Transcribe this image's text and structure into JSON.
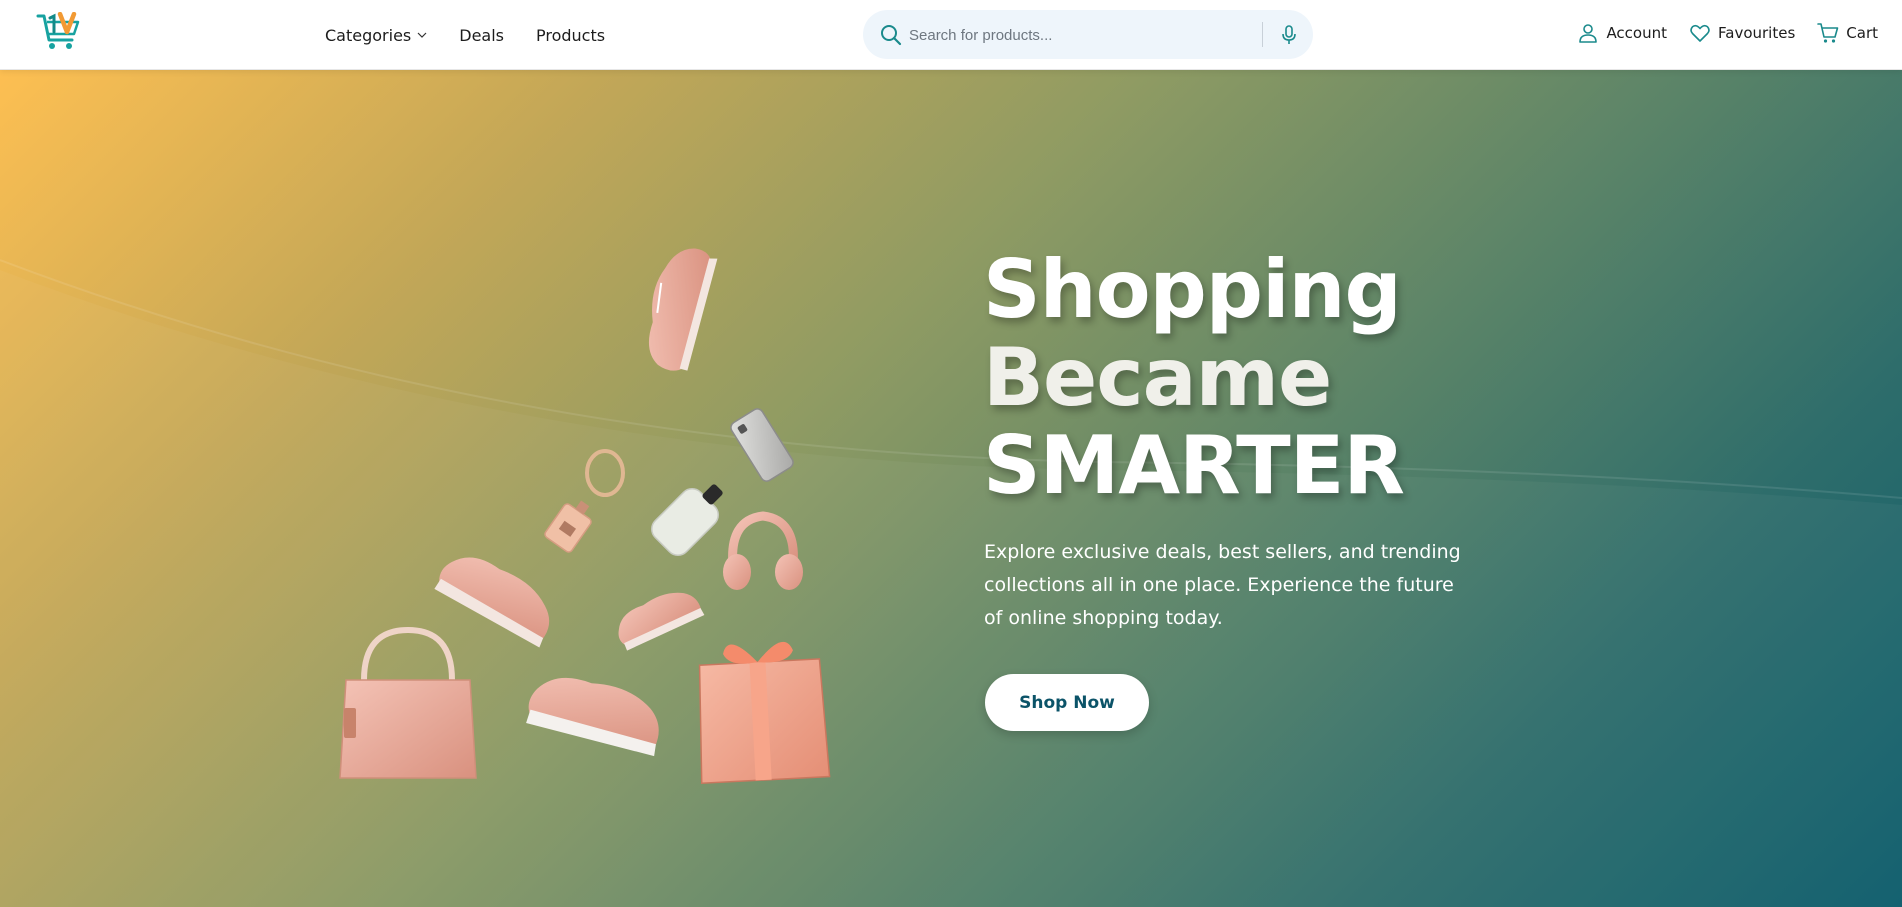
{
  "header": {
    "logo_icon": "cart-logo-icon",
    "nav": [
      {
        "label": "Categories",
        "icon": "chevron-down-icon"
      },
      {
        "label": "Deals"
      },
      {
        "label": "Products"
      }
    ],
    "search": {
      "placeholder": "Search for products...",
      "value": "",
      "icon": "search-icon",
      "mic_icon": "microphone-icon"
    },
    "actions": [
      {
        "label": "Account",
        "icon": "user-icon"
      },
      {
        "label": "Favourites",
        "icon": "heart-icon"
      },
      {
        "label": "Cart",
        "icon": "cart-icon"
      }
    ]
  },
  "hero": {
    "headline": [
      "Shopping",
      "Became",
      "SMARTER"
    ],
    "subtext": "Explore exclusive deals, best sellers, and trending collections all in one place. Experience the future of online shopping today.",
    "cta_label": "Shop Now",
    "colors": {
      "gradient_start": "#fdbf52",
      "gradient_mid": "#8f9b63",
      "gradient_end": "#0b5b6b",
      "cta_text": "#0b5368",
      "product_pink": "#e9a79a",
      "brand_teal": "#17a2a0",
      "brand_orange": "#f29a34"
    }
  }
}
